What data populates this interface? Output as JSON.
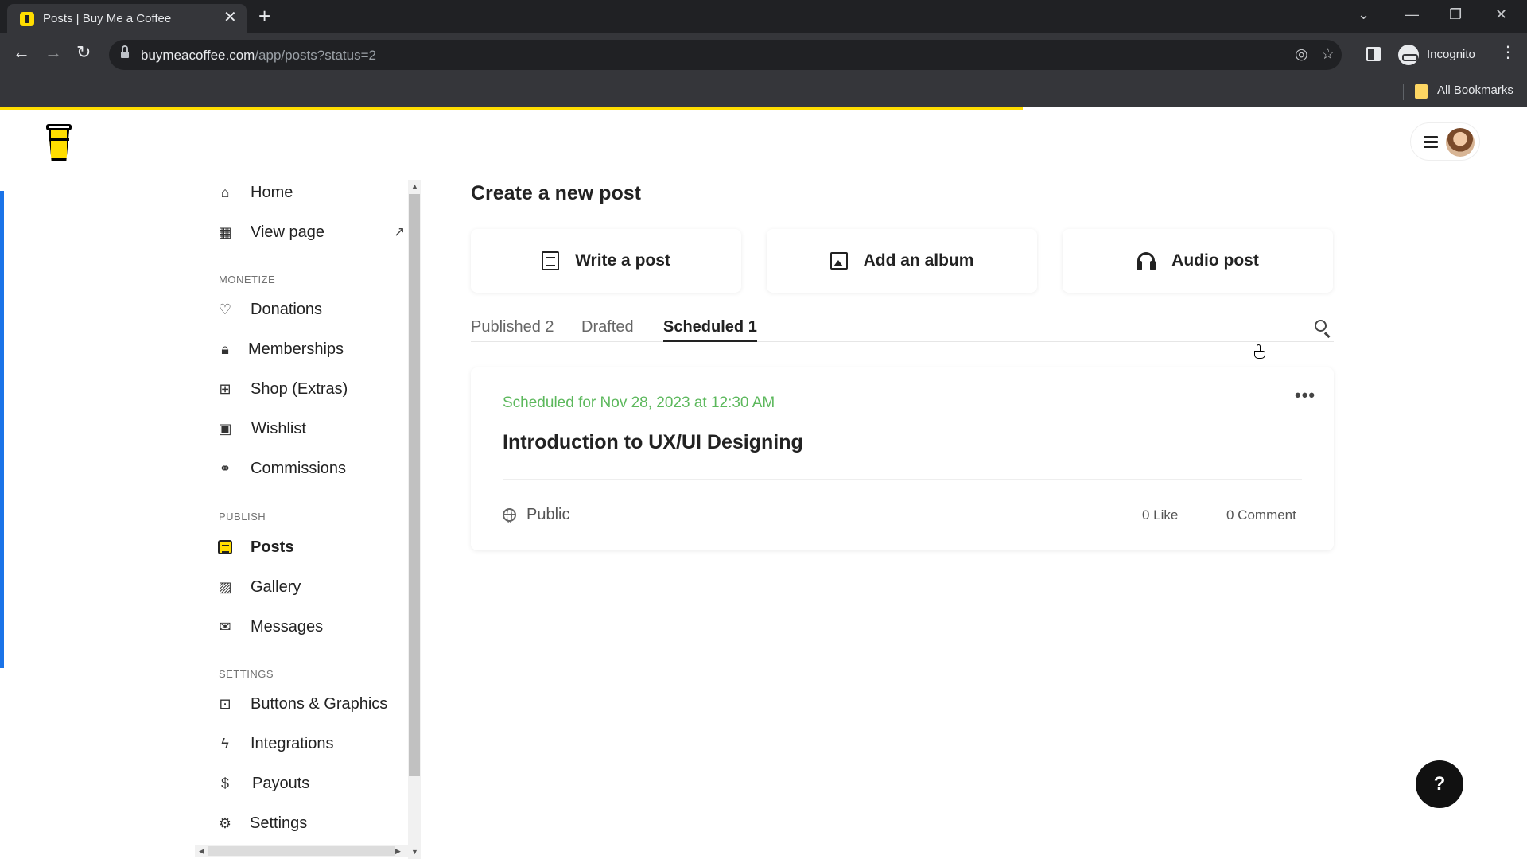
{
  "browser": {
    "tab_title": "Posts | Buy Me a Coffee",
    "tab_close": "✕",
    "new_tab": "+",
    "url_host": "buymeacoffee.com",
    "url_path": "/app/posts?status=2",
    "profile_label": "Incognito",
    "bookmarks_label": "All Bookmarks",
    "load_progress_pct": 67
  },
  "header": {
    "logo_name": "buy-me-a-coffee-logo"
  },
  "sidebar": {
    "top_items": [
      {
        "label": "Home",
        "icon": "home-icon"
      },
      {
        "label": "View page",
        "icon": "page-layout-icon"
      }
    ],
    "sections": {
      "monetize": "MONETIZE",
      "publish": "PUBLISH",
      "settings": "SETTINGS"
    },
    "monetize_items": [
      {
        "label": "Donations",
        "icon": "heart-icon"
      },
      {
        "label": "Memberships",
        "icon": "lock-icon"
      },
      {
        "label": "Shop (Extras)",
        "icon": "gift-icon"
      },
      {
        "label": "Wishlist",
        "icon": "calendar-heart-icon"
      },
      {
        "label": "Commissions",
        "icon": "handshake-icon"
      }
    ],
    "publish_items": [
      {
        "label": "Posts",
        "icon": "posts-icon",
        "active": true
      },
      {
        "label": "Gallery",
        "icon": "gallery-icon"
      },
      {
        "label": "Messages",
        "icon": "mail-icon"
      }
    ],
    "settings_items": [
      {
        "label": "Buttons & Graphics",
        "icon": "buttons-graphics-icon"
      },
      {
        "label": "Integrations",
        "icon": "lightning-icon"
      },
      {
        "label": "Payouts",
        "icon": "dollar-icon"
      },
      {
        "label": "Settings",
        "icon": "gear-icon"
      }
    ]
  },
  "main": {
    "title": "Create a new post",
    "create_options": [
      {
        "label": "Write a post",
        "icon": "document-icon"
      },
      {
        "label": "Add an album",
        "icon": "image-icon"
      },
      {
        "label": "Audio post",
        "icon": "headphones-icon"
      }
    ],
    "tabs": [
      {
        "label": "Published 2",
        "active": false
      },
      {
        "label": "Drafted",
        "active": false
      },
      {
        "label": "Scheduled 1",
        "active": true
      }
    ],
    "post": {
      "scheduled_text": "Scheduled for Nov 28, 2023 at 12:30 AM",
      "title": "Introduction to UX/UI Designing",
      "visibility": "Public",
      "likes": "0 Like",
      "comments": "0 Comment",
      "more": "•••"
    }
  },
  "help": {
    "label": "?"
  },
  "colors": {
    "brand_yellow": "#ffdd00",
    "scheduled_green": "#5cb85c",
    "chrome_dark": "#202124",
    "chrome_toolbar": "#35363a"
  }
}
